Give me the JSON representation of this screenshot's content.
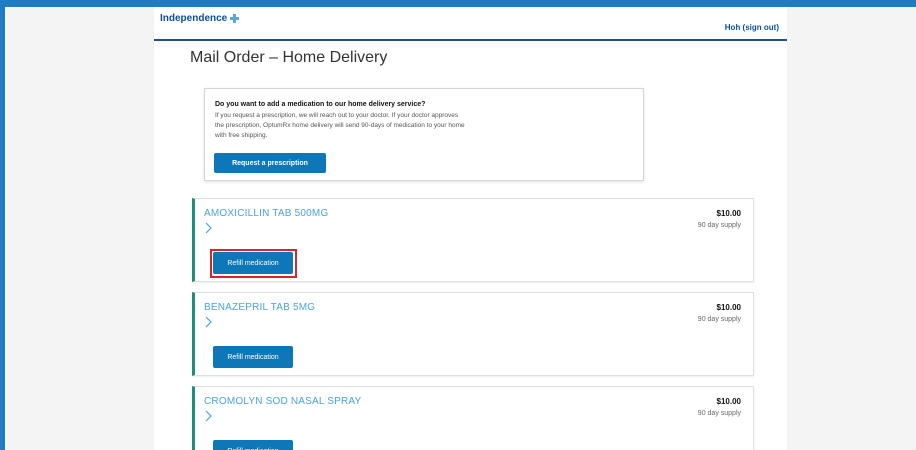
{
  "header": {
    "logo_text": "Independence",
    "signout_label": "Hoh (sign out)"
  },
  "page": {
    "title": "Mail Order – Home Delivery"
  },
  "promo": {
    "question": "Do you want to add a medication to our home delivery service?",
    "body": "If you request a prescription, we will reach out to your doctor. If your doctor approves the prescription, OptumRx home delivery will send 90-days of medication to your home with free shipping.",
    "button_label": "Request a prescription"
  },
  "medications": [
    {
      "name": "AMOXICILLIN TAB 500MG",
      "price": "$10.00",
      "supply": "90 day supply",
      "button_label": "Refill medication"
    },
    {
      "name": "BENAZEPRIL TAB 5MG",
      "price": "$10.00",
      "supply": "90 day supply",
      "button_label": "Refill medication"
    },
    {
      "name": "CROMOLYN SOD NASAL SPRAY",
      "price": "$10.00",
      "supply": "90 day supply",
      "button_label": "Refill medication"
    }
  ],
  "colors": {
    "brand_blue": "#0b4f9c",
    "button_blue": "#0d77b7",
    "accent_teal": "#1b8f7e",
    "med_name_blue": "#4aa3de",
    "highlight_red": "#d9232d",
    "outer_border": "#1f7cc4"
  },
  "icons": {
    "logo": "cross-logo-icon",
    "expand": "chevron-right-icon"
  }
}
